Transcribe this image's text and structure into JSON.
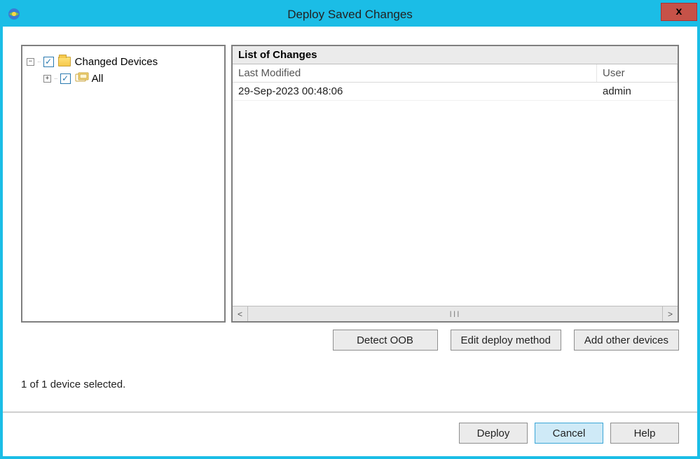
{
  "window": {
    "title": "Deploy Saved Changes",
    "close_label": "x"
  },
  "tree": {
    "root": {
      "label": "Changed Devices",
      "expand": "−",
      "checked": "✓"
    },
    "child": {
      "label": "All",
      "expand": "+",
      "checked": "✓"
    }
  },
  "list": {
    "header": "List of Changes",
    "columns": {
      "last_modified": "Last Modified",
      "user": "User"
    },
    "rows": [
      {
        "last_modified": "29-Sep-2023 00:48:06",
        "user": "admin"
      }
    ],
    "scroll_left": "<",
    "scroll_right": ">",
    "scroll_grip": "III"
  },
  "buttons": {
    "detect_oob": "Detect OOB",
    "edit_deploy_method": "Edit deploy method",
    "add_other_devices": "Add other devices",
    "deploy": "Deploy",
    "cancel": "Cancel",
    "help": "Help"
  },
  "status": "1 of 1 device selected."
}
